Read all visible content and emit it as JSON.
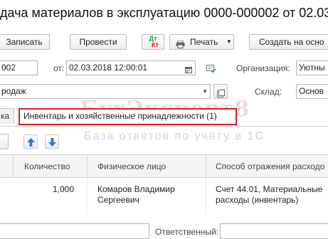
{
  "window": {
    "title": "дача материалов в эксплуатацию 0000-000002 от 02.03"
  },
  "toolbar": {
    "record_label": "Записать",
    "post_label": "Провести",
    "dtkt_label_dt": "Дт",
    "dtkt_label_kt": "Кт",
    "print_label": "Печать",
    "create_basis_label": "Создать на осно"
  },
  "header": {
    "number_value": "002",
    "from_label": "от:",
    "date_value": "02.03.2018 12:00:01",
    "organization_label": "Организация:",
    "organization_value": "Уютны",
    "operation_value": "родаж",
    "warehouse_label": "Склад:",
    "warehouse_value": "Основ"
  },
  "tabs": {
    "first_tab_label": "ка",
    "active_tab_label": "Инвентарь и хозяйственные принадлежности (1)"
  },
  "table": {
    "columns": [
      "Количество",
      "Физическое лицо",
      "Способ отражения расходо"
    ],
    "rows": [
      {
        "quantity": "1,000",
        "person_line1": "Комаров Владимир",
        "person_line2": "Сергеевич",
        "method_line1": "Счет 44.01, Материальные",
        "method_line2": "расходы (инвентарь)"
      }
    ]
  },
  "footer": {
    "responsible_label": "Ответственный:"
  },
  "watermark": {
    "main": "БухЭксперт8",
    "sub": "База ответов по учёту в 1С"
  },
  "colors": {
    "active_tab_border": "#d42020",
    "dtkt_green": "#2a9b2a",
    "dtkt_red": "#d42020",
    "arrow_blue": "#2f77c9"
  }
}
